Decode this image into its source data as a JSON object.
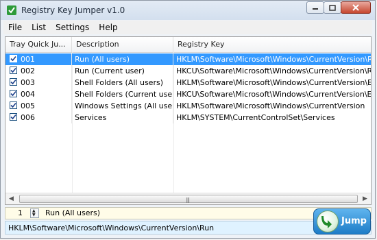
{
  "window": {
    "title": "Registry Key Jumper v1.0"
  },
  "menu": [
    "File",
    "List",
    "Settings",
    "Help"
  ],
  "table": {
    "columns": [
      "Tray Quick Ju...",
      "Description",
      "Registry Key"
    ],
    "rows": [
      {
        "checked": true,
        "id": "001",
        "description": "Run (All users)",
        "key": "HKLM\\Software\\Microsoft\\Windows\\CurrentVersion\\Run",
        "selected": true
      },
      {
        "checked": true,
        "id": "002",
        "description": "Run (Current user)",
        "key": "HKCU\\Software\\Microsoft\\Windows\\CurrentVersion\\Run",
        "selected": false
      },
      {
        "checked": true,
        "id": "003",
        "description": "Shell Folders (All users)",
        "key": "HKLM\\Software\\Microsoft\\Windows\\CurrentVersion\\Ex...",
        "selected": false
      },
      {
        "checked": true,
        "id": "004",
        "description": "Shell Folders (Current user)",
        "key": "HKCU\\Software\\Microsoft\\Windows\\CurrentVersion\\Ex...",
        "selected": false
      },
      {
        "checked": true,
        "id": "005",
        "description": "Windows Settings (All users)",
        "key": "HKLM\\Software\\Microsoft\\Windows\\CurrentVersion",
        "selected": false
      },
      {
        "checked": true,
        "id": "006",
        "description": "Services",
        "key": "HKLM\\SYSTEM\\CurrentControlSet\\Services",
        "selected": false
      }
    ]
  },
  "selection": {
    "number": "1",
    "name": "Run (All users)",
    "path": "HKLM\\Software\\Microsoft\\Windows\\CurrentVersion\\Run"
  },
  "jump_button": {
    "label": "Jump",
    "icon": "jump-arrow-icon"
  },
  "colors": {
    "selection": "#3399ff",
    "jump_button": "#2b8ad6",
    "path_background": "#dff2ff"
  }
}
